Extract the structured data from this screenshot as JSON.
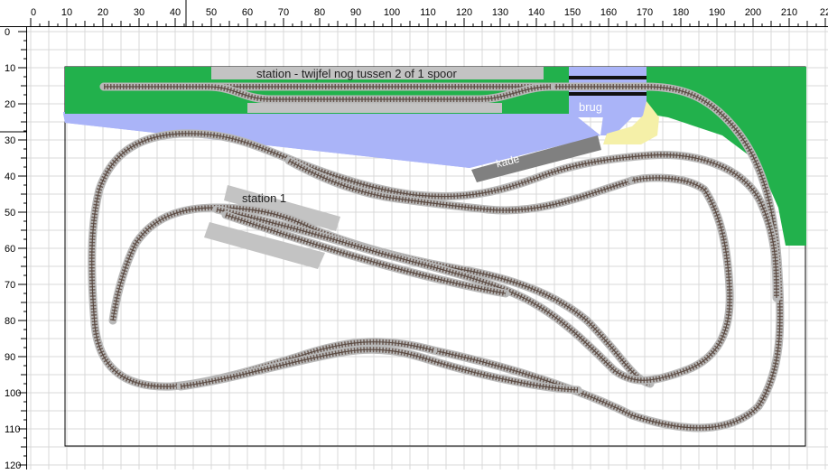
{
  "rulers": {
    "top_ticks": [
      "0",
      "10",
      "20",
      "30",
      "40",
      "50",
      "60",
      "70",
      "80",
      "90",
      "100",
      "110",
      "120",
      "130",
      "140",
      "150",
      "160",
      "170",
      "180",
      "190",
      "200",
      "210",
      "22"
    ],
    "left_ticks": [
      "0",
      "10",
      "20",
      "30",
      "40",
      "50",
      "60",
      "70",
      "80",
      "90",
      "100",
      "110",
      "120"
    ]
  },
  "labels": {
    "station_top": "station - twijfel nog tussen 2 of 1 spoor",
    "brug": "brug",
    "kade": "kade",
    "station_1": "station 1"
  },
  "colors": {
    "grass": "#22b14c",
    "water": "#aab4f8",
    "platform": "#c3c3c3",
    "kade": "#808080",
    "sand": "#f5f0a8",
    "grid": "#d8d8d8",
    "track_bed": "#b8b8b8",
    "track_rail": "#5a4a42"
  }
}
